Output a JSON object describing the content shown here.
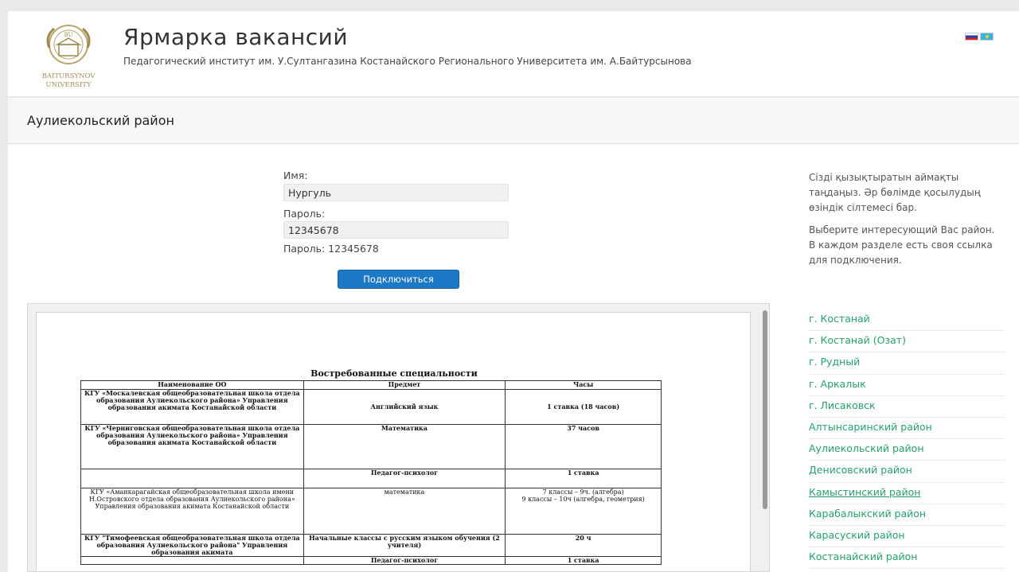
{
  "header": {
    "logo_text": "BAITURSYNOV UNIVERSITY",
    "title": "Ярмарка вакансий",
    "subtitle": "Педагогический институт им. У.Султангазина Костанайского Регионального Университета им. А.Байтурсынова",
    "languages": [
      "ru",
      "kz"
    ]
  },
  "section": {
    "title": "Аулиекольский район"
  },
  "form": {
    "name_label": "Имя:",
    "name_value": "Нургуль",
    "password_label": "Пароль:",
    "password_value": "12345678",
    "password_note": "Пароль: 12345678",
    "connect_label": "Подключиться"
  },
  "document": {
    "title": "Востребованные специальности",
    "columns": [
      "Наименование ОО",
      "Предмет",
      "Часы"
    ],
    "rows": [
      [
        "КГУ «Москалевская общеобразовательная школа отдела образования Аулиекольского района» Управления образования акимата Костанайской области",
        "Английский язык",
        "1 ставка (18 часов)"
      ],
      [
        "КГУ «Черниговская общеобразовательная школа отдела образования Аулиекольского района» Управления образования акимата Костанайской области",
        "Математика",
        "37 часов"
      ],
      [
        "",
        "Педагог-психолог",
        "1 ставка"
      ],
      [
        "КГУ «Аманкарагайская общеобразовательная школа имени Н.Островского отдела образования Аулиекольского района» Управления образования акимата Костанайской области",
        "математика",
        "7 классы – 9ч. (алгебра)\n9 классы – 10ч (алгебра, геометрия)"
      ],
      [
        "КГУ \"Тимофеевская общеобразовательная школа отдела образования Аулиекольского района\" Управления образования акимата",
        "Начальные классы с русским языком обучения (2 учителя)",
        "20 ч"
      ],
      [
        "",
        "Педагог-психолог",
        "1 ставка"
      ]
    ]
  },
  "sidebar": {
    "text_kz": "Сізді қызықтыратын аймақты таңдаңыз. Әр бөлімде қосылудың өзіндік сілтемесі бар.",
    "text_ru": "Выберите интересующий Вас район. В каждом разделе есть своя ссылка для подключения.",
    "districts": [
      "г. Костанай",
      "г. Костанай (Озат)",
      "г. Рудный",
      "г. Аркалык",
      "г. Лисаковск",
      "Алтынсаринский район",
      "Аулиекольский район",
      "Денисовский район",
      "Камыстинский район",
      "Карабалыкский район",
      "Карасуский район",
      "Костанайский район"
    ]
  }
}
